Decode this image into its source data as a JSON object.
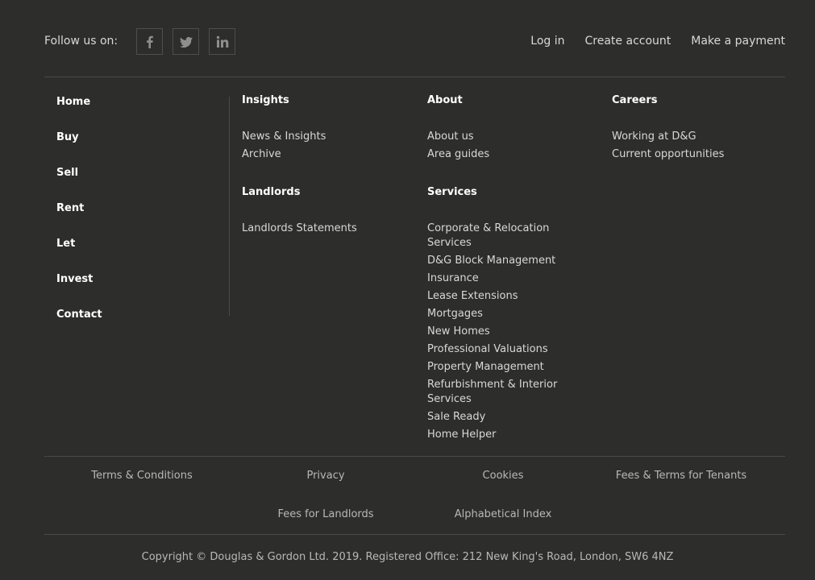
{
  "header": {
    "follow_label": "Follow us on:",
    "social": [
      {
        "name": "facebook-icon",
        "label": "f"
      },
      {
        "name": "twitter-icon",
        "label": "twitter"
      },
      {
        "name": "linkedin-icon",
        "label": "in"
      }
    ],
    "links": [
      "Log in",
      "Create account",
      "Make a payment"
    ]
  },
  "main_nav": [
    "Home",
    "Buy",
    "Sell",
    "Rent",
    "Let",
    "Invest",
    "Contact"
  ],
  "columns": {
    "insights": {
      "title": "Insights",
      "links": [
        "News & Insights",
        "Archive"
      ]
    },
    "landlords": {
      "title": "Landlords",
      "links": [
        "Landlords Statements"
      ]
    },
    "about": {
      "title": "About",
      "links": [
        "About us",
        "Area guides"
      ]
    },
    "services": {
      "title": "Services",
      "links": [
        "Corporate & Relocation Services",
        "D&G Block Management",
        "Insurance",
        "Lease Extensions",
        "Mortgages",
        "New Homes",
        "Professional Valuations",
        "Property Management",
        "Refurbishment & Interior Services",
        "Sale Ready",
        "Home Helper"
      ]
    },
    "careers": {
      "title": "Careers",
      "links": [
        "Working at D&G",
        "Current opportunities"
      ]
    }
  },
  "legal": {
    "row1": [
      "Terms & Conditions",
      "Privacy",
      "Cookies",
      "Fees & Terms for Tenants"
    ],
    "row2": [
      "Fees for Landlords",
      "Alphabetical Index"
    ]
  },
  "copyright": "Copyright © Douglas & Gordon Ltd. 2019. Registered Office: 212 New King's Road, London, SW6 4NZ",
  "colors": {
    "background": "#2d2d2c",
    "divider": "#4a4a48",
    "heading": "#ffffff",
    "link": "#d8d8d8",
    "muted": "#b8b8b6"
  }
}
